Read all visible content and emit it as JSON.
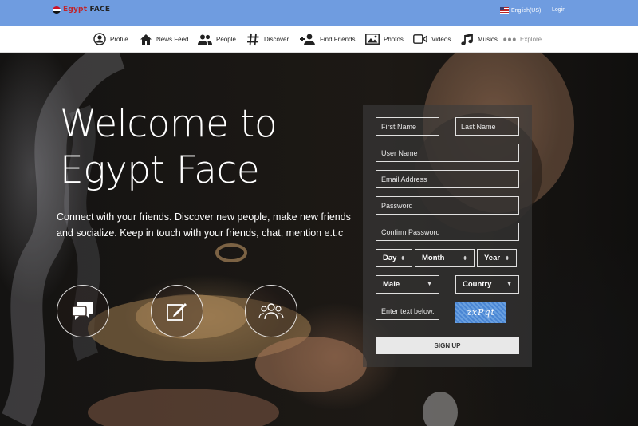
{
  "topbar": {
    "brand_prefix": "Egypt",
    "brand_suffix": "FACE",
    "language": "English(US)",
    "login": "Login",
    "colors": {
      "bar": "#6f9ce0",
      "brand_red": "#c0232a"
    }
  },
  "nav": {
    "items": [
      {
        "label": "Profile",
        "icon": "user-circle-icon"
      },
      {
        "label": "News Feed",
        "icon": "home-icon"
      },
      {
        "label": "People",
        "icon": "people-icon"
      },
      {
        "label": "Discover",
        "icon": "hashtag-icon"
      },
      {
        "label": "Find Friends",
        "icon": "add-user-icon"
      },
      {
        "label": "Photos",
        "icon": "photos-icon"
      },
      {
        "label": "Videos",
        "icon": "video-icon"
      },
      {
        "label": "Musics",
        "icon": "music-icon"
      },
      {
        "label": "Explore",
        "icon": "more-dots-icon"
      }
    ]
  },
  "hero": {
    "headline_line1": "Welcome to",
    "headline_line2": "Egypt Face",
    "tagline": "Connect with your friends. Discover new people, make new friends and socialize. Keep in touch with your friends, chat, mention e.t.c",
    "features": [
      "chat-icon",
      "edit-icon",
      "group-icon"
    ]
  },
  "signup": {
    "first_name_placeholder": "First Name",
    "last_name_placeholder": "Last Name",
    "username_placeholder": "User Name",
    "email_placeholder": "Email Address",
    "password_placeholder": "Password",
    "confirm_password_placeholder": "Confirm Password",
    "day": "Day",
    "month": "Month",
    "year": "Year",
    "gender": "Male",
    "country": "Country",
    "captcha_placeholder": "Enter text below...",
    "captcha_text": "zxPqt",
    "submit": "SIGN UP"
  }
}
